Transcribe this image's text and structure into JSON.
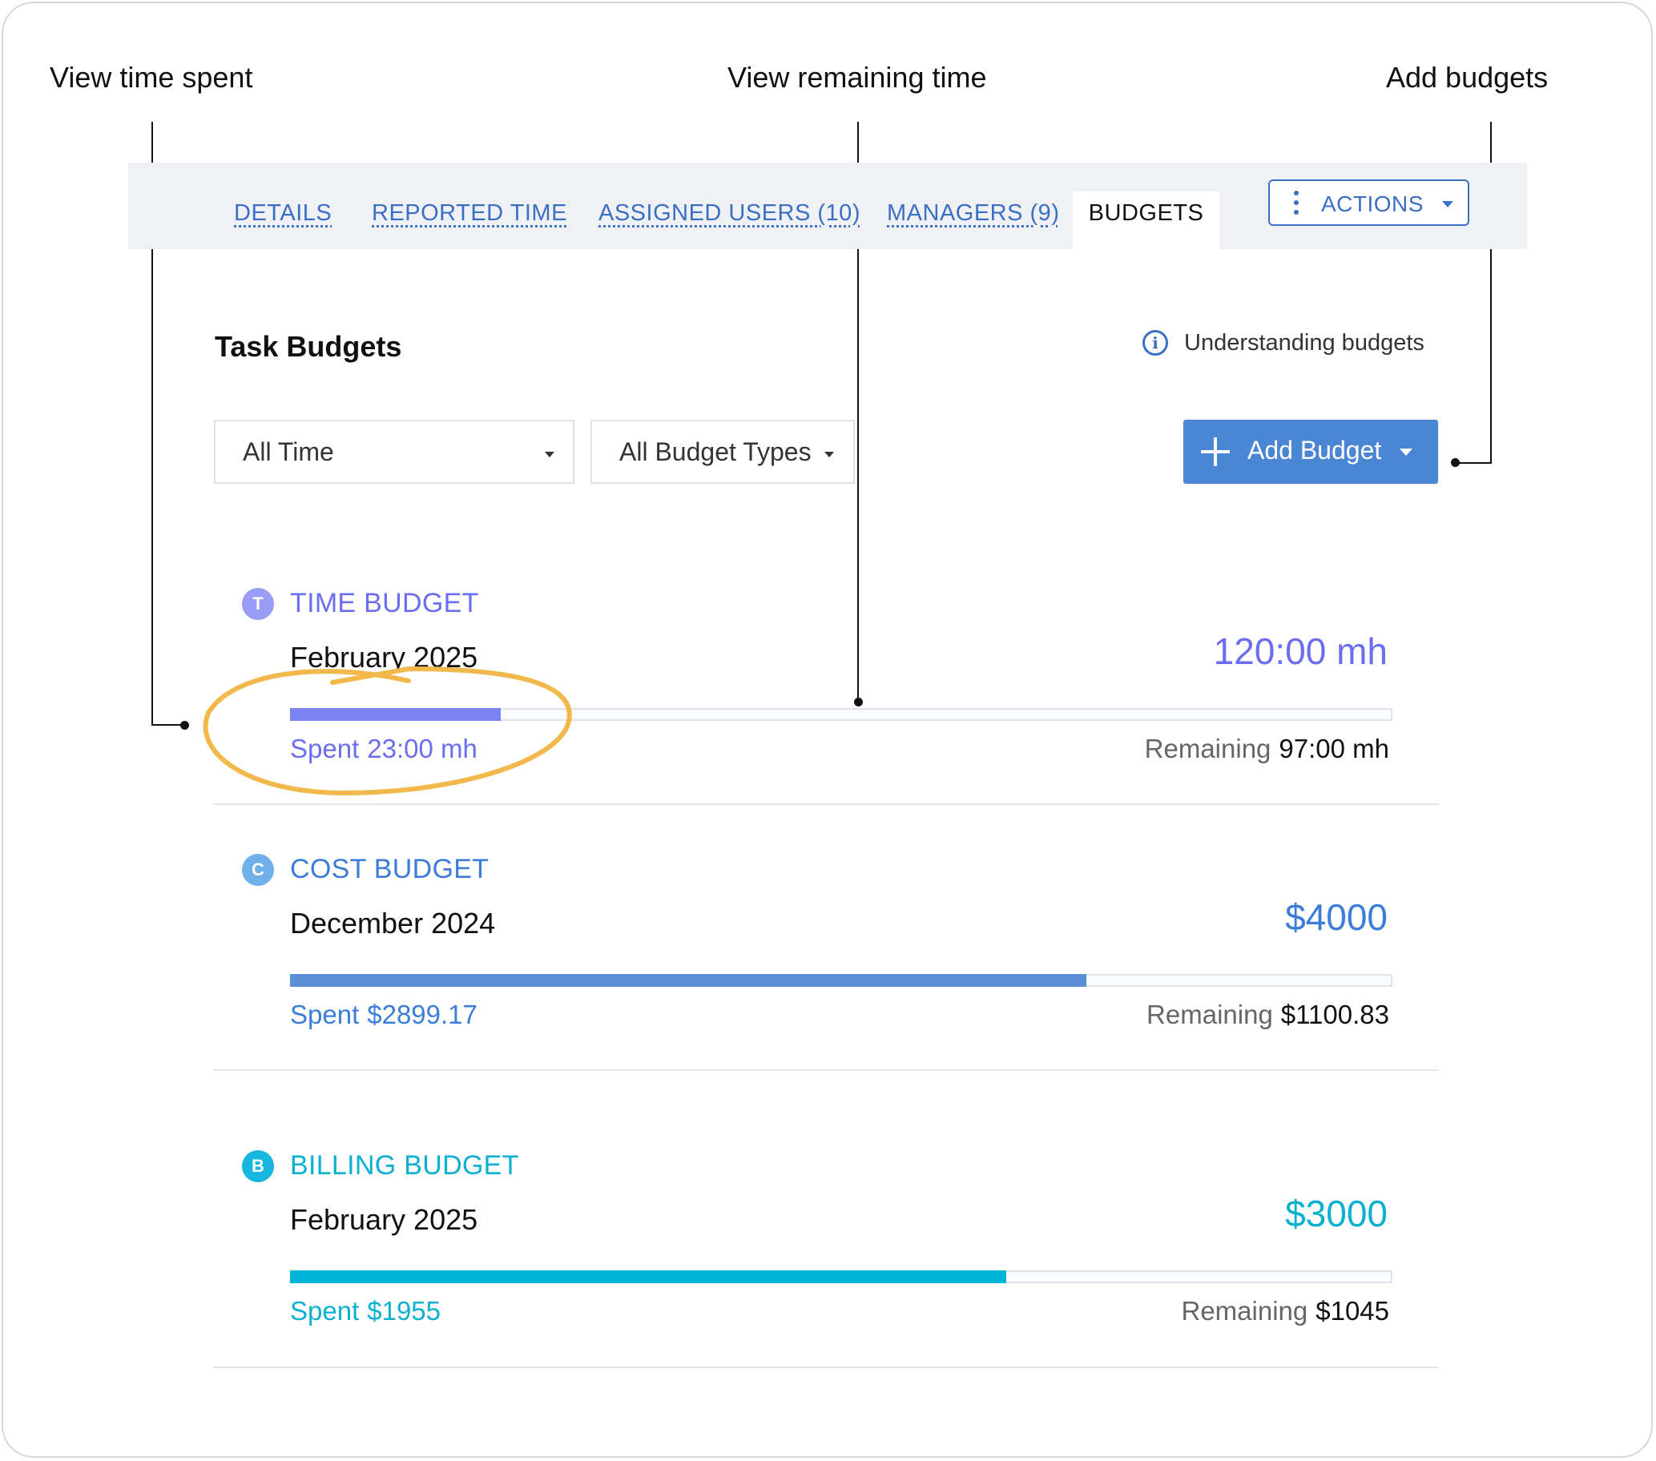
{
  "annotations": {
    "spent": "View time spent",
    "remaining": "View remaining time",
    "add": "Add budgets"
  },
  "tabs": [
    {
      "label": "DETAILS"
    },
    {
      "label": "REPORTED TIME"
    },
    {
      "label": "ASSIGNED USERS (10)"
    },
    {
      "label": "MANAGERS (9)"
    },
    {
      "label": "BUDGETS",
      "active": true
    }
  ],
  "actions": {
    "label": "ACTIONS"
  },
  "page": {
    "title": "Task Budgets",
    "help_link": "Understanding budgets",
    "help_icon": "info-icon"
  },
  "filters": {
    "period": "All Time",
    "type": "All Budget Types"
  },
  "add_budget": {
    "label": "Add Budget",
    "icon": "plus-icon"
  },
  "colors": {
    "link": "#3a6fc4",
    "time": "#6b6ef0",
    "time_fill": "#7b83f2",
    "cost": "#3b7dd8",
    "cost_fill": "#5a8fd6",
    "billing": "#0ab0d0",
    "billing_fill": "#00b4d8",
    "highlight": "#f2b84b"
  },
  "budgets": [
    {
      "badge": "T",
      "type": "TIME BUDGET",
      "period": "February 2025",
      "total": "120:00 mh",
      "spent_label": "Spent",
      "spent_value": "23:00 mh",
      "remaining_label": "Remaining",
      "remaining_value": "97:00 mh",
      "progress": 0.1917
    },
    {
      "badge": "C",
      "type": "COST BUDGET",
      "period": "December 2024",
      "total": "$4000",
      "spent_label": "Spent",
      "spent_value": "$2899.17",
      "remaining_label": "Remaining",
      "remaining_value": "$1100.83",
      "progress": 0.7248
    },
    {
      "badge": "B",
      "type": "BILLING BUDGET",
      "period": "February 2025",
      "total": "$3000",
      "spent_label": "Spent",
      "spent_value": "$1955",
      "remaining_label": "Remaining",
      "remaining_value": "$1045",
      "progress": 0.6517
    }
  ]
}
